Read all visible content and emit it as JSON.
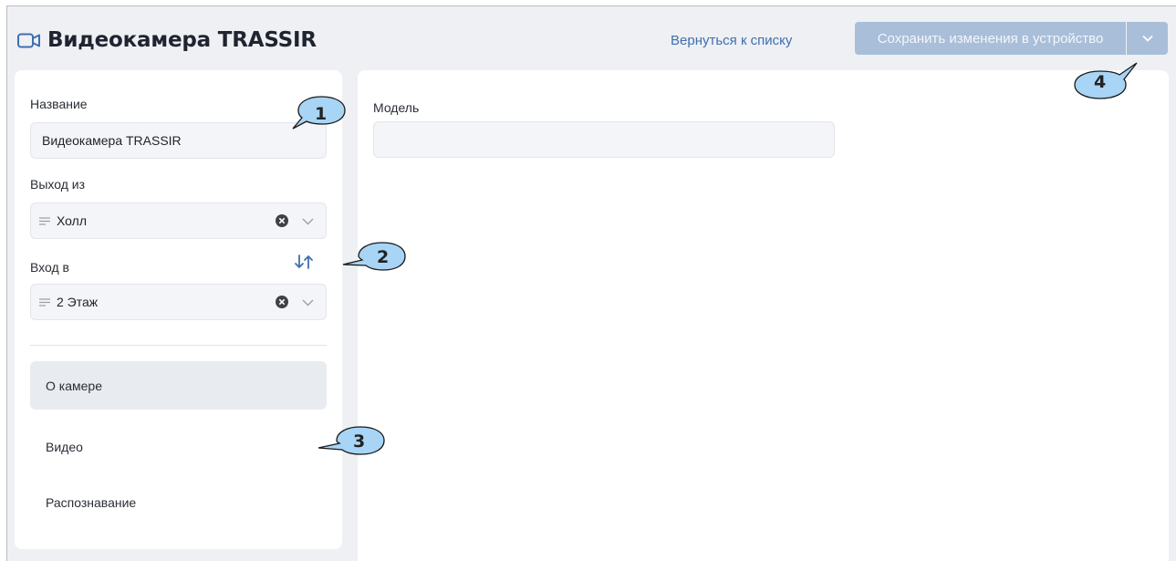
{
  "header": {
    "title": "Видеокамера TRASSIR",
    "title_icon": "camera-icon",
    "back_link": "Вернуться к списку",
    "save_label": "Сохранить изменения в устройство",
    "save_dropdown_icon": "chevron-down-icon"
  },
  "left": {
    "name": {
      "label": "Название",
      "value": "Видеокамера TRASSIR"
    },
    "exit_from": {
      "label": "Выход из",
      "value": "Холл"
    },
    "enter_to": {
      "label": "Вход в",
      "value": "2 Этаж"
    },
    "swap_icon": "swap-arrows-icon",
    "nav": [
      {
        "label": "О камере",
        "active": true
      },
      {
        "label": "Видео",
        "active": false
      },
      {
        "label": "Распознавание",
        "active": false
      }
    ]
  },
  "right": {
    "model": {
      "label": "Модель",
      "value": ""
    }
  },
  "callouts": [
    "1",
    "2",
    "3",
    "4"
  ],
  "colors": {
    "background": "#eef0f3",
    "accent": "#3f6fb0",
    "button_disabled": "#a9bed9",
    "callout_fill": "#a8d4f5"
  }
}
